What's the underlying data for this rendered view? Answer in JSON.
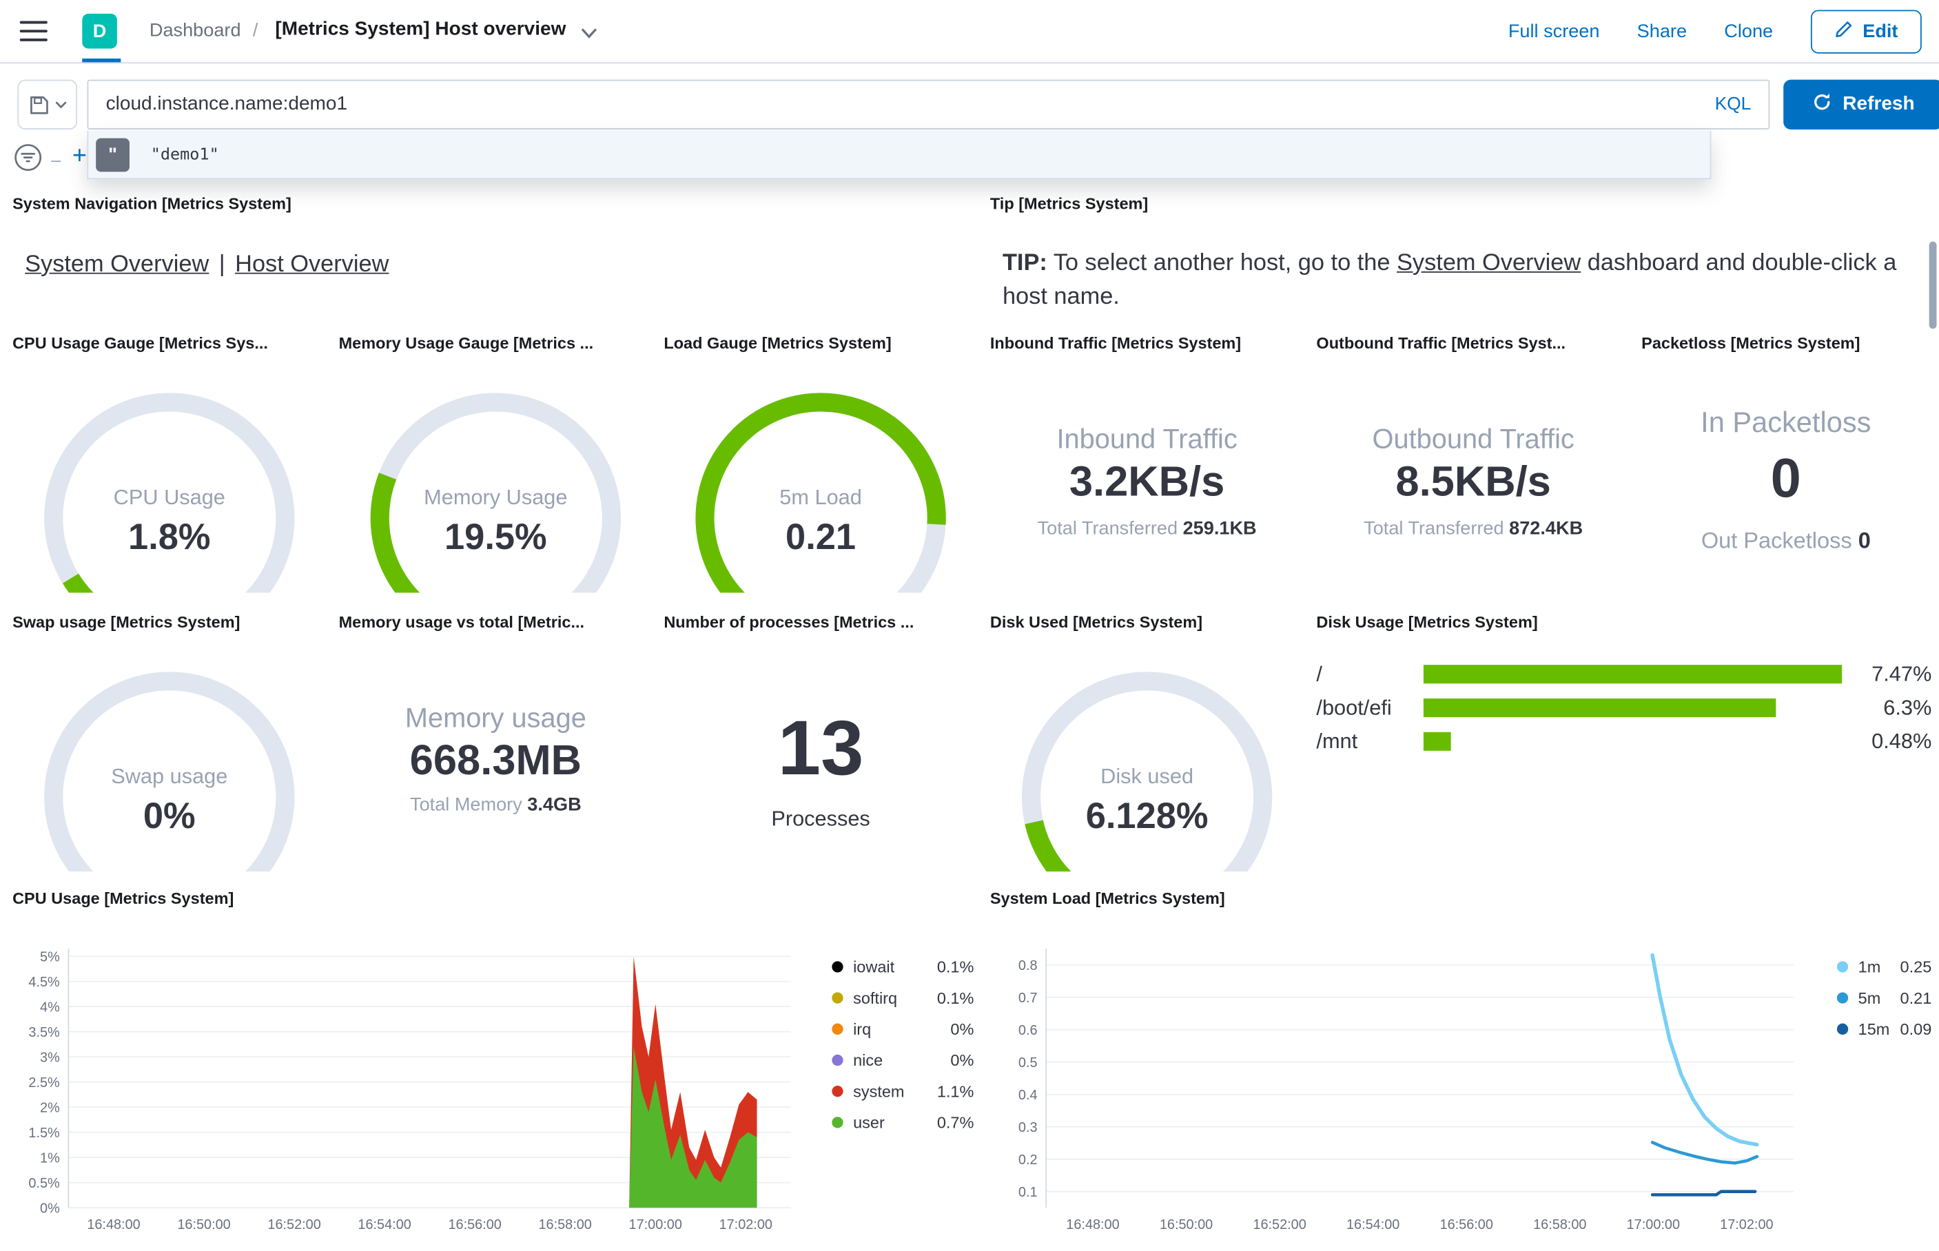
{
  "colors": {
    "blue": "#0071C2",
    "teal": "#00BFB3",
    "green": "#68BC00",
    "track": "#E0E6EF",
    "dark": "#343741",
    "gray": "#98A2B3"
  },
  "header": {
    "space_initial": "D",
    "breadcrumb_root": "Dashboard",
    "breadcrumb_sep": "/",
    "breadcrumb_current": "[Metrics System] Host overview",
    "full_screen": "Full screen",
    "share": "Share",
    "clone": "Clone",
    "edit": "Edit"
  },
  "query": {
    "value": "cloud.instance.name:demo1",
    "language": "KQL",
    "refresh_label": "Refresh",
    "suggestion": "\"demo1\"",
    "add_filter": "+"
  },
  "panels": {
    "system_nav": {
      "title": "System Navigation [Metrics System]",
      "link1": "System Overview",
      "separator": "|",
      "link2": "Host Overview"
    },
    "tip": {
      "title": "Tip [Metrics System]",
      "bold": "TIP:",
      "text_before": " To select another host, go to the ",
      "link": "System Overview",
      "text_after": " dashboard and double-click a host name."
    },
    "cpu_gauge": {
      "title": "CPU Usage Gauge [Metrics Sys...",
      "label": "CPU Usage",
      "value": "1.8%",
      "fraction": 0.05
    },
    "memory_gauge": {
      "title": "Memory Usage Gauge [Metrics ...",
      "label": "Memory Usage",
      "value": "19.5%",
      "fraction": 0.245
    },
    "load_gauge": {
      "title": "Load Gauge [Metrics System]",
      "label": "5m Load",
      "value": "0.21",
      "fraction": 0.845
    },
    "inbound": {
      "title": "Inbound Traffic [Metrics System]",
      "label": "Inbound Traffic",
      "value": "3.2KB/s",
      "sub_label": "Total Transferred",
      "sub_value": "259.1KB"
    },
    "outbound": {
      "title": "Outbound Traffic [Metrics Syst...",
      "label": "Outbound Traffic",
      "value": "8.5KB/s",
      "sub_label": "Total Transferred",
      "sub_value": "872.4KB"
    },
    "packetloss": {
      "title": "Packetloss [Metrics System]",
      "in_label": "In Packetloss",
      "in_value": "0",
      "out_label": "Out Packetloss",
      "out_value": "0"
    },
    "swap_gauge": {
      "title": "Swap usage [Metrics System]",
      "label": "Swap usage",
      "value": "0%",
      "fraction": 0
    },
    "memory_total": {
      "title": "Memory usage vs total [Metric...",
      "label": "Memory usage",
      "value": "668.3MB",
      "sub_label": "Total Memory",
      "sub_value": "3.4GB"
    },
    "processes": {
      "title": "Number of processes [Metrics ...",
      "value": "13",
      "label": "Processes"
    },
    "disk_gauge": {
      "title": "Disk Used [Metrics System]",
      "label": "Disk used",
      "value": "6.128%",
      "fraction": 0.12
    },
    "disk_usage": {
      "title": "Disk Usage [Metrics System]"
    },
    "cpu_chart": {
      "title": "CPU Usage [Metrics System]"
    },
    "load_chart": {
      "title": "System Load [Metrics System]"
    }
  },
  "chart_data": [
    {
      "type": "area",
      "title": "CPU Usage [Metrics System]",
      "xlim": [
        0,
        16
      ],
      "ylim": [
        0,
        5.15
      ],
      "x_ticks": [
        {
          "v": 1,
          "label": "16:48:00"
        },
        {
          "v": 3,
          "label": "16:50:00"
        },
        {
          "v": 5,
          "label": "16:52:00"
        },
        {
          "v": 7,
          "label": "16:54:00"
        },
        {
          "v": 9,
          "label": "16:56:00"
        },
        {
          "v": 11,
          "label": "16:58:00"
        },
        {
          "v": 13,
          "label": "17:00:00"
        },
        {
          "v": 15,
          "label": "17:02:00"
        }
      ],
      "y_ticks": [
        {
          "v": 5,
          "label": "5%"
        },
        {
          "v": 4.5,
          "label": "4.5%"
        },
        {
          "v": 4,
          "label": "4%"
        },
        {
          "v": 3.5,
          "label": "3.5%"
        },
        {
          "v": 3,
          "label": "3%"
        },
        {
          "v": 2.5,
          "label": "2.5%"
        },
        {
          "v": 2,
          "label": "2%"
        },
        {
          "v": 1.5,
          "label": "1.5%"
        },
        {
          "v": 1,
          "label": "1%"
        },
        {
          "v": 0.5,
          "label": "0.5%"
        },
        {
          "v": 0,
          "label": "0%"
        }
      ],
      "areas": [
        {
          "name": "system",
          "color": "#D6331F",
          "points": [
            [
              12.42,
              0
            ],
            [
              12.52,
              5.0
            ],
            [
              12.7,
              3.6
            ],
            [
              12.85,
              3.0
            ],
            [
              13.0,
              4.05
            ],
            [
              13.2,
              2.6
            ],
            [
              13.35,
              1.55
            ],
            [
              13.55,
              2.3
            ],
            [
              13.75,
              1.2
            ],
            [
              13.9,
              0.95
            ],
            [
              14.1,
              1.55
            ],
            [
              14.3,
              1.0
            ],
            [
              14.45,
              0.8
            ],
            [
              14.65,
              1.4
            ],
            [
              14.85,
              2.05
            ],
            [
              15.05,
              2.3
            ],
            [
              15.25,
              2.15
            ]
          ]
        },
        {
          "name": "user",
          "color": "#54B72B",
          "points": [
            [
              12.42,
              0
            ],
            [
              12.52,
              3.2
            ],
            [
              12.7,
              2.3
            ],
            [
              12.85,
              1.9
            ],
            [
              13.0,
              2.55
            ],
            [
              13.2,
              1.6
            ],
            [
              13.35,
              0.95
            ],
            [
              13.55,
              1.45
            ],
            [
              13.75,
              0.75
            ],
            [
              13.9,
              0.55
            ],
            [
              14.1,
              0.95
            ],
            [
              14.3,
              0.6
            ],
            [
              14.45,
              0.5
            ],
            [
              14.65,
              0.9
            ],
            [
              14.85,
              1.35
            ],
            [
              15.05,
              1.5
            ],
            [
              15.25,
              1.4
            ]
          ]
        }
      ],
      "legend": [
        {
          "label": "iowait",
          "color": "#000000",
          "value": "0.1%"
        },
        {
          "label": "softirq",
          "color": "#C2A800",
          "value": "0.1%"
        },
        {
          "label": "irq",
          "color": "#F0870F",
          "value": "0%"
        },
        {
          "label": "nice",
          "color": "#8775D8",
          "value": "0%"
        },
        {
          "label": "system",
          "color": "#D6331F",
          "value": "1.1%"
        },
        {
          "label": "user",
          "color": "#54B72B",
          "value": "0.7%"
        }
      ]
    },
    {
      "type": "line",
      "title": "System Load [Metrics System]",
      "xlim": [
        0,
        16
      ],
      "ylim": [
        0.05,
        0.85
      ],
      "x_ticks": [
        {
          "v": 1,
          "label": "16:48:00"
        },
        {
          "v": 3,
          "label": "16:50:00"
        },
        {
          "v": 5,
          "label": "16:52:00"
        },
        {
          "v": 7,
          "label": "16:54:00"
        },
        {
          "v": 9,
          "label": "16:56:00"
        },
        {
          "v": 11,
          "label": "16:58:00"
        },
        {
          "v": 13,
          "label": "17:00:00"
        },
        {
          "v": 15,
          "label": "17:02:00"
        }
      ],
      "y_ticks": [
        {
          "v": 0.8,
          "label": "0.8"
        },
        {
          "v": 0.7,
          "label": "0.7"
        },
        {
          "v": 0.6,
          "label": "0.6"
        },
        {
          "v": 0.5,
          "label": "0.5"
        },
        {
          "v": 0.4,
          "label": "0.4"
        },
        {
          "v": 0.3,
          "label": "0.3"
        },
        {
          "v": 0.2,
          "label": "0.2"
        },
        {
          "v": 0.1,
          "label": "0.1"
        }
      ],
      "lines": [
        {
          "name": "1m",
          "color": "#79CFF5",
          "width": 3,
          "points": [
            [
              12.98,
              0.83
            ],
            [
              13.15,
              0.7
            ],
            [
              13.35,
              0.57
            ],
            [
              13.6,
              0.46
            ],
            [
              13.85,
              0.385
            ],
            [
              14.1,
              0.33
            ],
            [
              14.35,
              0.295
            ],
            [
              14.6,
              0.27
            ],
            [
              14.85,
              0.255
            ],
            [
              15.1,
              0.248
            ],
            [
              15.22,
              0.245
            ]
          ]
        },
        {
          "name": "5m",
          "color": "#2B99D4",
          "width": 2.5,
          "points": [
            [
              12.98,
              0.252
            ],
            [
              13.25,
              0.235
            ],
            [
              13.55,
              0.222
            ],
            [
              13.85,
              0.21
            ],
            [
              14.15,
              0.2
            ],
            [
              14.45,
              0.192
            ],
            [
              14.75,
              0.188
            ],
            [
              15.0,
              0.195
            ],
            [
              15.22,
              0.208
            ]
          ]
        },
        {
          "name": "15m",
          "color": "#155FA2",
          "width": 2.5,
          "points": [
            [
              12.98,
              0.09
            ],
            [
              14.35,
              0.09
            ],
            [
              14.45,
              0.1
            ],
            [
              15.18,
              0.1
            ]
          ]
        }
      ],
      "legend": [
        {
          "label": "1m",
          "color": "#79CFF5",
          "value": "0.25"
        },
        {
          "label": "5m",
          "color": "#2B99D4",
          "value": "0.21"
        },
        {
          "label": "15m",
          "color": "#155FA2",
          "value": "0.09"
        }
      ]
    },
    {
      "type": "bar",
      "orientation": "horizontal",
      "title": "Disk Usage [Metrics System]",
      "categories": [
        "/",
        "/boot/efi",
        "/mnt"
      ],
      "values": [
        7.47,
        6.3,
        0.48
      ],
      "value_labels": [
        "7.47%",
        "6.3%",
        "0.48%"
      ],
      "color": "#68BC00",
      "xlim": [
        0,
        7.47
      ]
    }
  ]
}
